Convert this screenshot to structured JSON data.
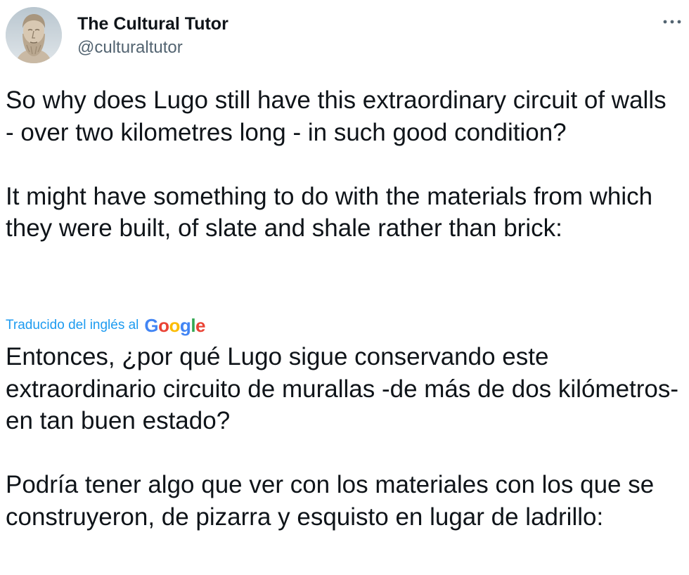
{
  "author": {
    "display_name": "The Cultural Tutor",
    "handle": "@culturaltutor",
    "avatar_icon": "bust-avatar-icon"
  },
  "menu": {
    "icon": "more-horizontal-icon"
  },
  "tweet": {
    "text": "So why does Lugo still have this extraordinary circuit of walls - over two kilometres long - in such good condition?\n\nIt might have something to do with the materials from which they were built, of slate and shale rather than brick:"
  },
  "translation": {
    "label": "Traducido del inglés al",
    "provider": "Google",
    "text": "Entonces, ¿por qué Lugo sigue conservando este extraordinario circuito de murallas -de más de dos kilómetros- en tan buen estado?\n\nPodría tener algo que ver con los materiales con los que se construyeron, de pizarra y esquisto en lugar de ladrillo:"
  },
  "colors": {
    "text": "#0f1419",
    "secondary": "#536471",
    "link": "#1d9bf0"
  }
}
